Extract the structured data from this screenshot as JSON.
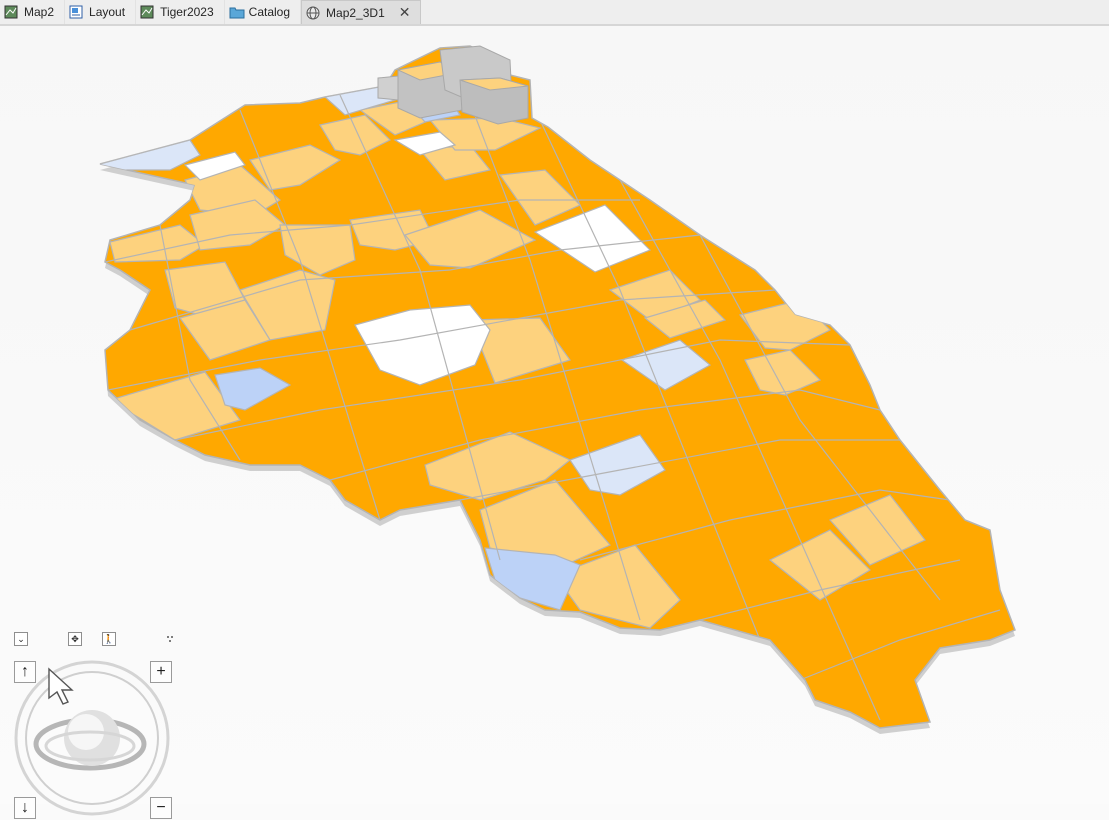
{
  "tabs": [
    {
      "label": "Map2",
      "icon": "map-icon",
      "active": false
    },
    {
      "label": "Layout",
      "icon": "layout-icon",
      "active": false
    },
    {
      "label": "Tiger2023",
      "icon": "map-icon",
      "active": false
    },
    {
      "label": "Catalog",
      "icon": "catalog-folder-icon",
      "active": false
    },
    {
      "label": "Map2_3D1",
      "icon": "globe-icon",
      "active": true,
      "closable": true
    }
  ],
  "close_glyph": "✕",
  "scene": {
    "legend_colors": {
      "dark_orange": "#ffa800",
      "light_orange": "#fdd27e",
      "light_blue": "#dbe6f8",
      "blue": "#bcd2f7",
      "white": "#ffffff",
      "outline": "#b4b4b4",
      "extrusion": "#c6c6c6"
    }
  },
  "nav": {
    "collapse_glyph": "⌄",
    "pan_glyph": "✥",
    "walk_glyph": "🚶",
    "up_glyph": "↑",
    "down_glyph": "↓",
    "zoom_in_glyph": "+",
    "zoom_out_glyph": "−"
  }
}
